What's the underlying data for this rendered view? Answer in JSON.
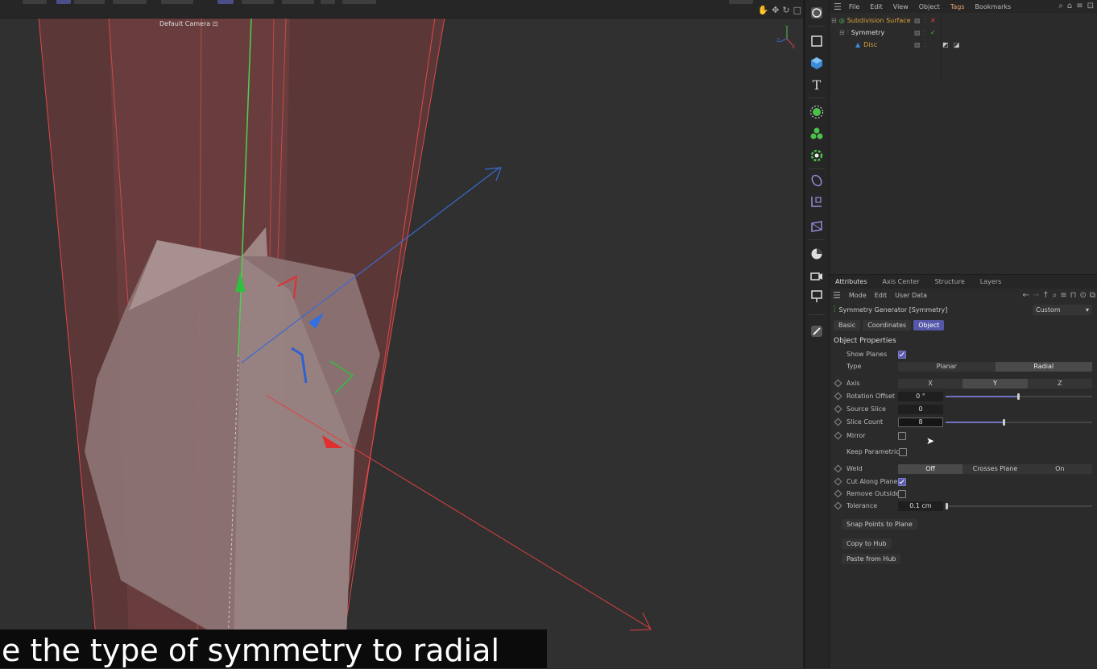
{
  "viewport": {
    "camera_label": "Default Camera",
    "subtitle": "e the type of symmetry to radial"
  },
  "object_manager": {
    "menu": [
      "File",
      "Edit",
      "View",
      "Object",
      "Tags",
      "Bookmarks"
    ],
    "active_menu": "Tags",
    "objects": [
      {
        "name": "Subdivision Surface",
        "color": "#d9a03a"
      },
      {
        "name": "Symmetry",
        "color": "#e0e0e0"
      },
      {
        "name": "Disc",
        "color": "#d9a03a"
      }
    ]
  },
  "attributes": {
    "tabs": [
      "Attributes",
      "Axis Center",
      "Structure",
      "Layers"
    ],
    "menu": [
      "Mode",
      "Edit",
      "User Data"
    ],
    "object_title": "Symmetry Generator [Symmetry]",
    "preset": "Custom",
    "subtabs": [
      "Basic",
      "Coordinates",
      "Object"
    ],
    "active_subtab": "Object",
    "section_title": "Object Properties",
    "props": {
      "show_planes": {
        "label": "Show Planes",
        "checked": true
      },
      "type": {
        "label": "Type",
        "options": [
          "Planar",
          "Radial"
        ],
        "selected": "Radial"
      },
      "axis": {
        "label": "Axis",
        "options": [
          "X",
          "Y",
          "Z"
        ],
        "selected": "Y"
      },
      "rotation_offset": {
        "label": "Rotation Offset",
        "value": "0 °"
      },
      "source_slice": {
        "label": "Source Slice",
        "value": "0"
      },
      "slice_count": {
        "label": "Slice Count",
        "value": "8"
      },
      "mirror": {
        "label": "Mirror",
        "checked": false
      },
      "keep_parametric": {
        "label": "Keep Parametric",
        "checked": false
      },
      "weld": {
        "label": "Weld",
        "options": [
          "Off",
          "Crosses Plane",
          "On"
        ],
        "selected": "Off"
      },
      "cut_along_plane": {
        "label": "Cut Along Plane",
        "checked": true
      },
      "remove_outside": {
        "label": "Remove Outside",
        "checked": false
      },
      "tolerance": {
        "label": "Tolerance",
        "value": "0.1 cm"
      }
    },
    "buttons": {
      "snap": "Snap Points to Plane",
      "copy": "Copy to Hub",
      "paste": "Paste from Hub"
    }
  },
  "colors": {
    "accent": "#5558a8",
    "axis_x": "#e03030",
    "axis_y": "#30c040",
    "axis_z": "#3070e0"
  }
}
